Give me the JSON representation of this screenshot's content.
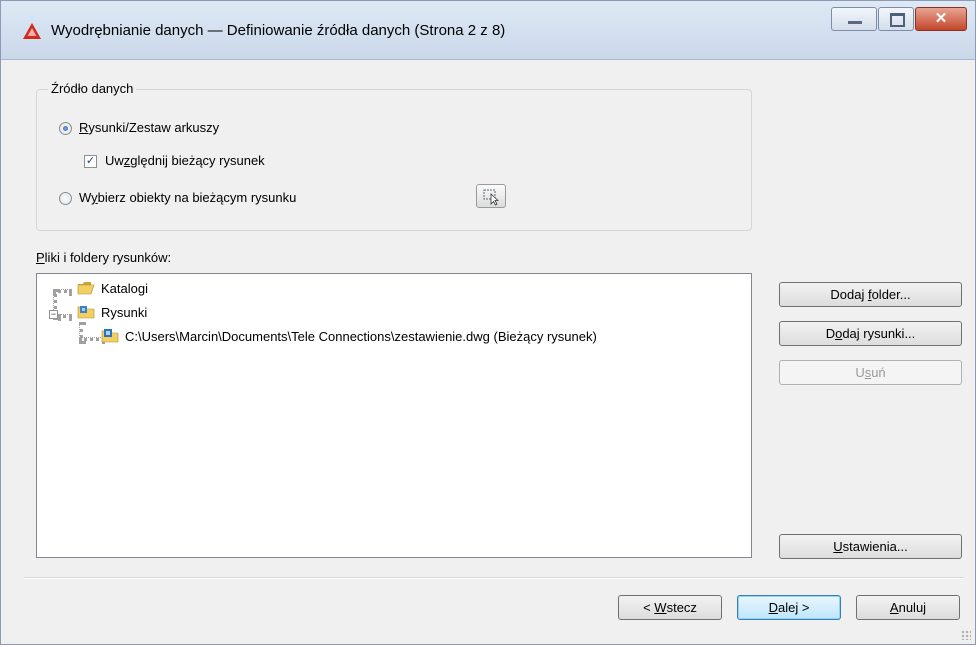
{
  "window": {
    "title": "Wyodrębnianie danych — Definiowanie źródła danych (Strona 2 z 8)",
    "close_glyph": "✕"
  },
  "source_group": {
    "title": "Źródło danych",
    "radio_drawings": {
      "mnemonic": "R",
      "rest": "ysunki/Zestaw arkuszy",
      "checked": true
    },
    "checkbox_current": {
      "pre": "Uw",
      "mnemonic": "z",
      "post": "ględnij bieżący rysunek",
      "checked": true,
      "mark": "✓"
    },
    "radio_objects": {
      "pre": "W",
      "mnemonic": "y",
      "post": "bierz obiekty na bieżącym rysunku",
      "checked": false
    }
  },
  "files": {
    "label_mnemonic": "P",
    "label_rest": "liki i foldery rysunków:",
    "tree": [
      {
        "label": "Katalogi",
        "icon": "folder-open-icon"
      },
      {
        "label": "Rysunki",
        "icon": "drawing-folder-icon",
        "expander": "−"
      },
      {
        "label": "C:\\Users\\Marcin\\Documents\\Tele Connections\\zestawienie.dwg (Bieżący rysunek)",
        "icon": "dwg-file-icon"
      }
    ]
  },
  "buttons": {
    "add_folder": {
      "pre": "Dodaj ",
      "mnemonic": "f",
      "post": "older..."
    },
    "add_drawings": {
      "pre": "D",
      "mnemonic": "o",
      "post": "daj rysunki..."
    },
    "remove": {
      "pre": "U",
      "mnemonic": "s",
      "post": "uń"
    },
    "settings": {
      "pre": "",
      "mnemonic": "U",
      "post": "stawienia..."
    },
    "back": {
      "pre": "< ",
      "mnemonic": "W",
      "post": "stecz"
    },
    "next": {
      "pre": "",
      "mnemonic": "D",
      "post": "alej >"
    },
    "cancel": {
      "pre": "",
      "mnemonic": "A",
      "post": "nuluj"
    }
  },
  "colors": {
    "accent": "#3c7fb1",
    "app_icon": "#d2281e"
  }
}
